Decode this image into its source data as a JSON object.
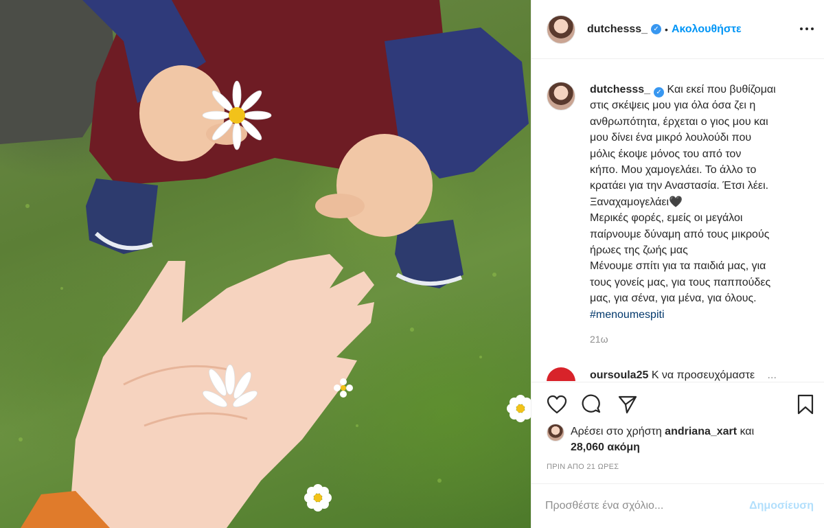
{
  "post": {
    "username": "dutchesss_",
    "verified_mark": "✓",
    "separator": "•",
    "follow_label": "Ακολουθήστε",
    "caption_lines": [
      "Και εκεί που βυθίζομαι",
      "στις σκέψεις μου για όλα όσα ζει η",
      "ανθρωπότητα, έρχεται ο γιος μου και",
      "μου δίνει ένα μικρό λουλούδι που",
      "μόλις έκοψε μόνος του από τον",
      "κήπο. Μου χαμογελάει. Το άλλο το",
      "κρατάει για την Αναστασία. Έτσι λέει.",
      "Ξαναχαμογελάει🖤",
      "Μερικές φορές, εμείς οι μεγάλοι",
      "παίρνουμε δύναμη από τους μικρούς",
      "ήρωες της ζωής μας ",
      "Μένουμε σπίτι για τα παιδιά μας, για",
      "τους γονείς μας, για τους παππούδες",
      "μας, για σένα, για μένα, για όλους."
    ],
    "hashtag": "#menoumespiti",
    "age": "21ω",
    "comment_preview": {
      "username": "oursoula25",
      "text": "Κ να προσευχόμαστε",
      "more": "..."
    }
  },
  "actions": {
    "icons": [
      "heart-icon",
      "comment-icon",
      "share-icon",
      "bookmark-icon"
    ]
  },
  "likes": {
    "prefix": "Αρέσει στο χρήστη",
    "liker": "andriana_xart",
    "conj": "και",
    "count": "28,060",
    "suffix": "ακόμη"
  },
  "timestamp": "ΠΡΙΝ ΑΠΟ 21 ΩΡΕΣ",
  "comment_box": {
    "placeholder": "Προσθέστε ένα σχόλιο...",
    "post_label": "Δημοσίευση"
  },
  "colors": {
    "accent": "#0095f6",
    "hashtag": "#00376b",
    "muted": "#8e8e8e",
    "post_disabled": "#b2dffc"
  }
}
